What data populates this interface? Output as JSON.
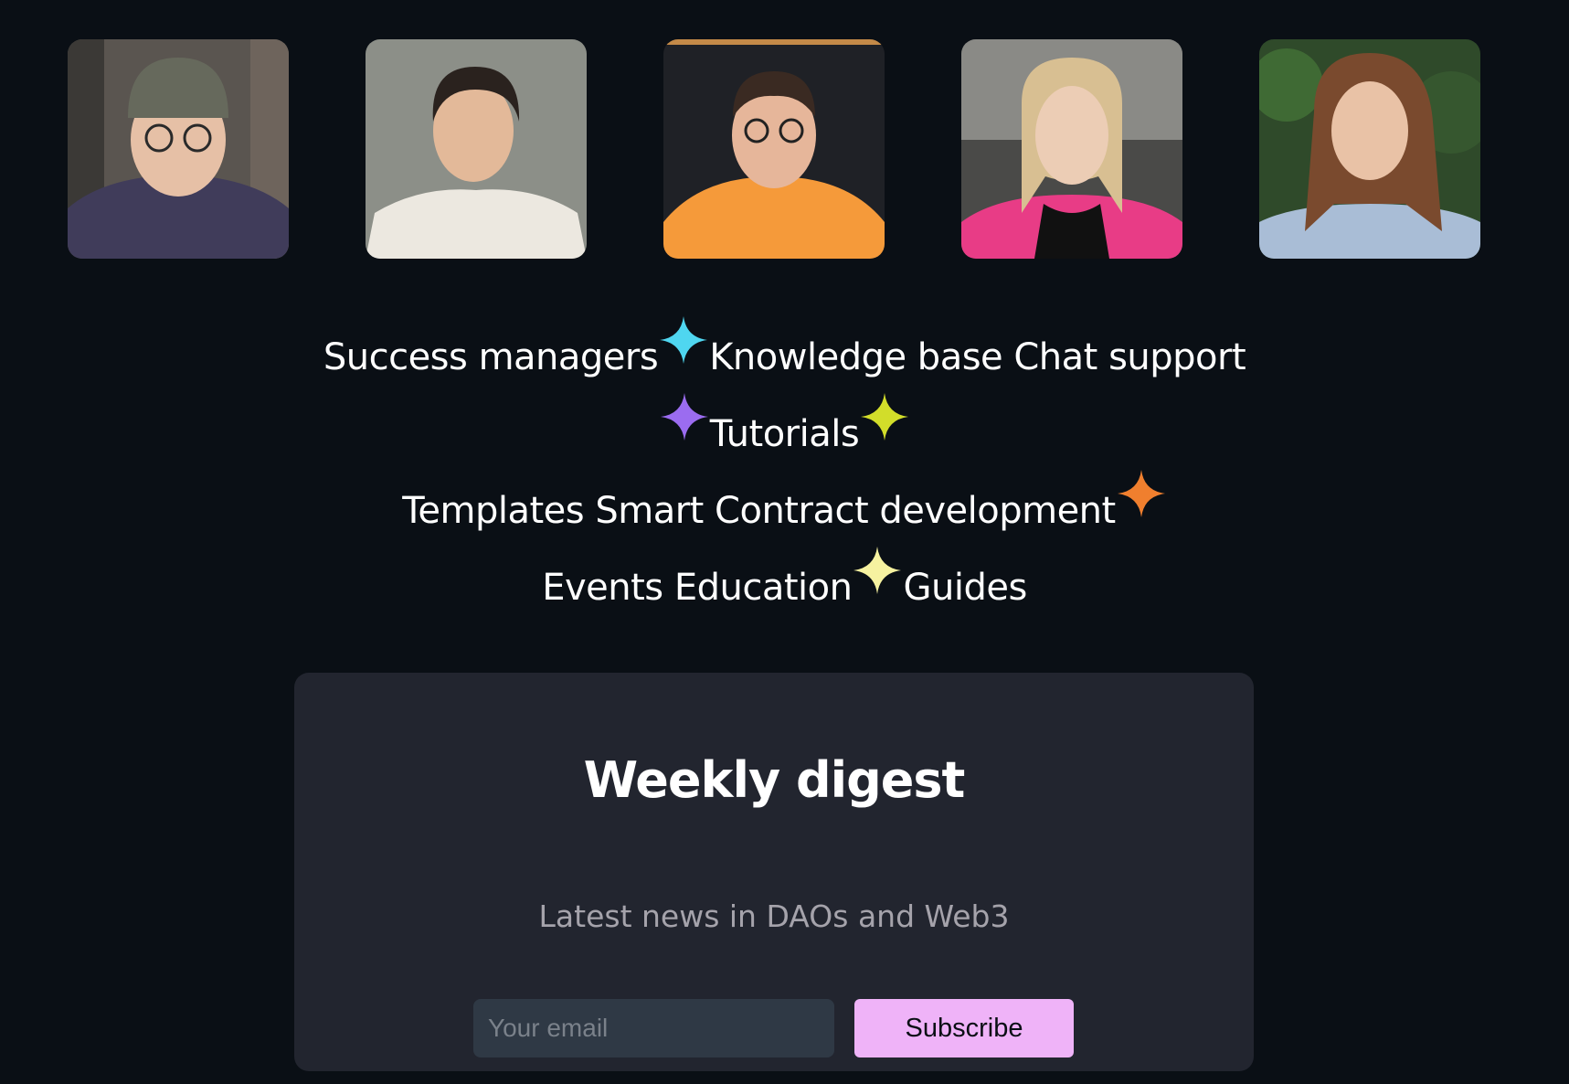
{
  "team": [
    {
      "name": "avatar-1",
      "icon": "person-beanie-glasses"
    },
    {
      "name": "avatar-2",
      "icon": "person-white-shirt"
    },
    {
      "name": "avatar-3",
      "icon": "person-orange-hoodie"
    },
    {
      "name": "avatar-4",
      "icon": "person-pink-jacket"
    },
    {
      "name": "avatar-5",
      "icon": "person-floral-top"
    }
  ],
  "features": {
    "success_managers": "Success managers",
    "knowledge_base": "Knowledge base",
    "chat_support": "Chat support",
    "tutorials": "Tutorials",
    "templates": "Templates",
    "smart_contract": "Smart Contract development",
    "events": "Events",
    "education": "Education",
    "guides": "Guides"
  },
  "sparkles": {
    "cyan": "#4fd6f0",
    "purple": "#9b6cf0",
    "lime": "#d2dd2a",
    "orange": "#f07f2e",
    "yellow": "#f6f2a0"
  },
  "digest": {
    "title": "Weekly digest",
    "subtitle": "Latest news in DAOs and Web3",
    "email_placeholder": "Your email",
    "email_value": "",
    "subscribe_label": "Subscribe"
  },
  "colors": {
    "background": "#0a0f15",
    "card": "#22252f",
    "button": "#efb3f8"
  }
}
